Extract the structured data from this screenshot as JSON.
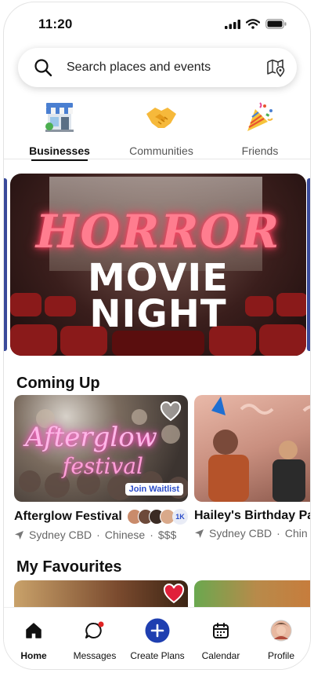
{
  "status_bar": {
    "time": "11:20"
  },
  "search": {
    "placeholder": "Search places and events"
  },
  "tabs": [
    {
      "label": "Businesses",
      "icon": "shop-icon",
      "active": true
    },
    {
      "label": "Communities",
      "icon": "handshake-icon",
      "active": false
    },
    {
      "label": "Friends",
      "icon": "party-popper-icon",
      "active": false
    }
  ],
  "hero": {
    "line1": "HORROR",
    "line2": "MOVIE",
    "line3": "NIGHT"
  },
  "coming_up": {
    "title": "Coming Up",
    "cards": [
      {
        "name": "Afterglow Festival",
        "image_text_1": "Afterglow",
        "image_text_2": "festival",
        "location": "Sydney CBD",
        "cuisine": "Chinese",
        "price": "$$$",
        "badge": "Join Waitlist",
        "attendees_count": "1K"
      },
      {
        "name": "Hailey's Birthday Pa",
        "location": "Sydney CBD",
        "cuisine": "Chin"
      }
    ]
  },
  "favourites": {
    "title": "My Favourites"
  },
  "nav": [
    {
      "label": "Home",
      "icon": "home-icon",
      "active": true
    },
    {
      "label": "Messages",
      "icon": "chat-icon",
      "active": false
    },
    {
      "label": "Create Plans",
      "icon": "plus-icon",
      "active": false
    },
    {
      "label": "Calendar",
      "icon": "calendar-icon",
      "active": false
    },
    {
      "label": "Profile",
      "icon": "avatar",
      "active": false
    }
  ],
  "colors": {
    "accent": "#1f3fb0",
    "neon_pink": "#ff7d8f",
    "notification": "#e02424"
  }
}
